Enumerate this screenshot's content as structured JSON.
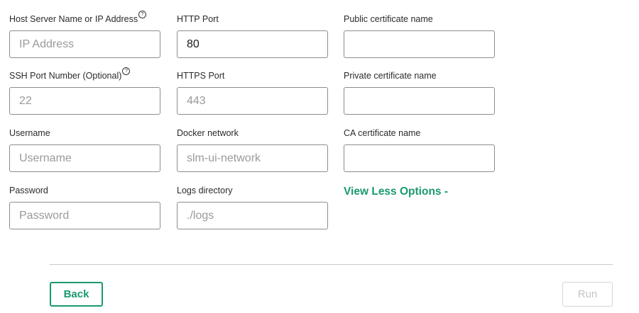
{
  "fields": {
    "host": {
      "label": "Host Server Name or IP Address",
      "help": "?",
      "placeholder": "IP Address",
      "value": ""
    },
    "http_port": {
      "label": "HTTP Port",
      "placeholder": "",
      "value": "80"
    },
    "public_cert": {
      "label": "Public certificate name",
      "placeholder": "",
      "value": ""
    },
    "ssh_port": {
      "label": "SSH Port Number (Optional)",
      "help": "?",
      "placeholder": "22",
      "value": ""
    },
    "https_port": {
      "label": "HTTPS Port",
      "placeholder": "443",
      "value": ""
    },
    "private_cert": {
      "label": "Private certificate name",
      "placeholder": "",
      "value": ""
    },
    "username": {
      "label": "Username",
      "placeholder": "Username",
      "value": ""
    },
    "docker_network": {
      "label": "Docker network",
      "placeholder": "slm-ui-network",
      "value": ""
    },
    "ca_cert": {
      "label": "CA certificate name",
      "placeholder": "",
      "value": ""
    },
    "password": {
      "label": "Password",
      "placeholder": "Password",
      "value": ""
    },
    "logs_dir": {
      "label": "Logs directory",
      "placeholder": "./logs",
      "value": ""
    }
  },
  "options_toggle": "View Less Options -",
  "footer": {
    "back_label": "Back",
    "run_label": "Run"
  },
  "colors": {
    "accent": "#1a9a6c",
    "disabled_text": "#c4c4c4",
    "input_border": "#8c8c8c"
  }
}
